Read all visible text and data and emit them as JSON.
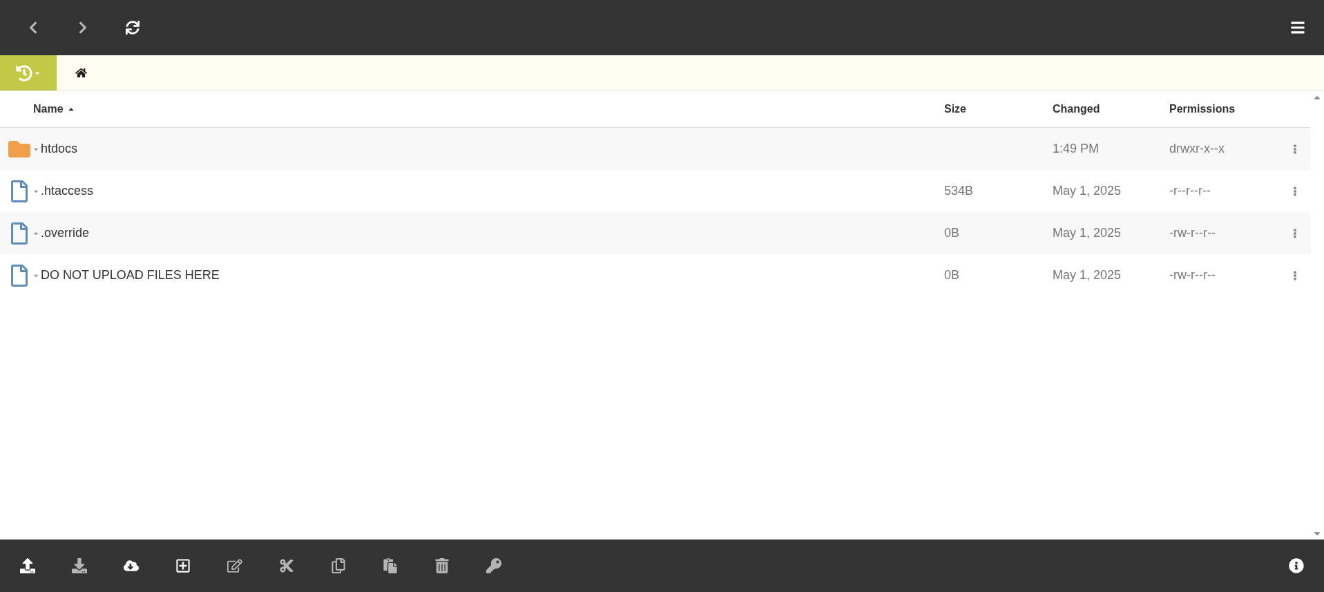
{
  "nav_bar": {
    "buttons": [
      {
        "kind": "back",
        "disabled": true
      },
      {
        "kind": "forward",
        "disabled": true
      },
      {
        "kind": "refresh",
        "disabled": false
      }
    ]
  },
  "table": {
    "columns": [
      {
        "label": "Name",
        "sorted": true
      },
      {
        "label": "Size",
        "sorted": false
      },
      {
        "label": "Changed",
        "sorted": false
      },
      {
        "label": "Permissions",
        "sorted": false
      }
    ],
    "rows": [
      {
        "kind": "folder",
        "name": "htdocs",
        "size": "",
        "changed": "1:49 PM",
        "permissions": "drwxr-x--x"
      },
      {
        "kind": "file",
        "name": ".htaccess",
        "size": "534B",
        "changed": "May 1, 2025",
        "permissions": "-r--r--r--"
      },
      {
        "kind": "file",
        "name": ".override",
        "size": "0B",
        "changed": "May 1, 2025",
        "permissions": "-rw-r--r--"
      },
      {
        "kind": "file",
        "name": "DO NOT UPLOAD FILES HERE",
        "size": "0B",
        "changed": "May 1, 2025",
        "permissions": "-rw-r--r--"
      }
    ]
  },
  "toolbar": [
    {
      "kind": "upload",
      "disabled": false
    },
    {
      "kind": "download",
      "disabled": true
    },
    {
      "kind": "cloud-download",
      "disabled": false
    },
    {
      "kind": "new",
      "disabled": false
    },
    {
      "kind": "rename",
      "disabled": true
    },
    {
      "kind": "cut",
      "disabled": true
    },
    {
      "kind": "copy",
      "disabled": true
    },
    {
      "kind": "paste",
      "disabled": true
    },
    {
      "kind": "delete",
      "disabled": true
    },
    {
      "kind": "permissions",
      "disabled": true
    }
  ]
}
